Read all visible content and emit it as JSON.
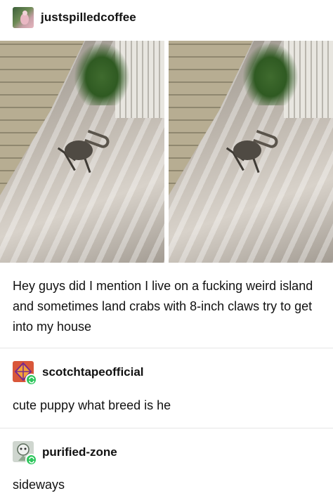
{
  "post": {
    "username": "justspilledcoffee",
    "caption": "Hey guys did I mention I live on a fucking weird island and sometimes land crabs with 8-inch claws try to get into my house"
  },
  "reblogs": [
    {
      "username": "scotchtapeofficial",
      "text": "cute puppy what breed is he",
      "avatar_icon": "kite-icon"
    },
    {
      "username": "purified-zone",
      "text": "sideways",
      "avatar_icon": "character-icon"
    }
  ],
  "colors": {
    "reblog_badge": "#2dc65c",
    "divider": "#e6e6e6",
    "text": "#111111"
  }
}
